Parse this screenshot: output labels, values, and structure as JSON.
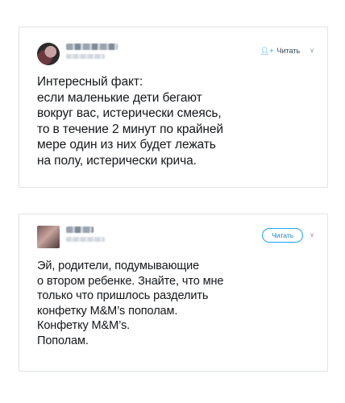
{
  "tweets": [
    {
      "follow_label": "Читать",
      "follow_icon": "person-plus-icon",
      "text": "Интересный факт:\nесли маленькие дети бегают\nвокруг вас, истерически смеясь,\nто в течение 2 минут по крайней\nмере один из них будет лежать\nна полу, истерически крича."
    },
    {
      "follow_label": "Читать",
      "text": "Эй, родители, подумывающие\nо втором ребенке. Знайте, что мне\nтолько что пришлось разделить\nконфетку M&M’s пополам.\nКонфетку M&M’s.\nПополам."
    }
  ],
  "icons": {
    "chevron": "chevron-down-icon",
    "person": "person-plus-icon"
  },
  "colors": {
    "accent": "#1da1f2",
    "text": "#14171a",
    "border": "#dfe3e8",
    "muted": "#8899a6"
  }
}
